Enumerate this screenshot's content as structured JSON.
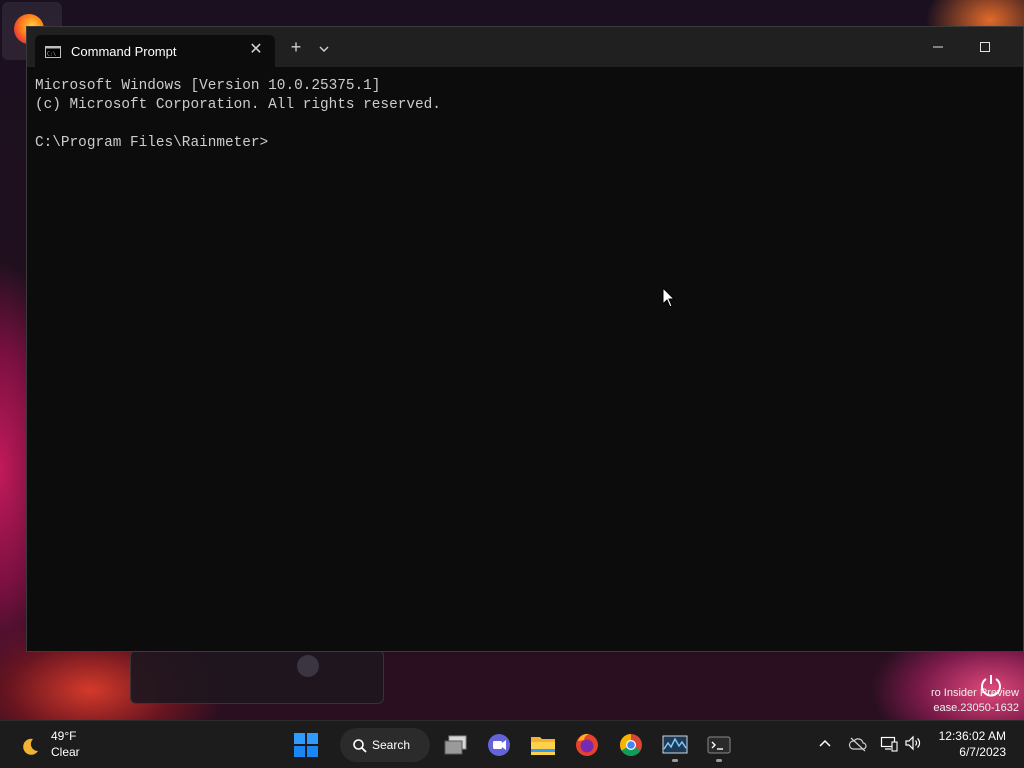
{
  "desktop": {
    "insider_line1": "ro Insider Preview",
    "insider_line2": "ease.23050-1632"
  },
  "window": {
    "tab_title": "Command Prompt",
    "console_lines": [
      "Microsoft Windows [Version 10.0.25375.1]",
      "(c) Microsoft Corporation. All rights reserved.",
      "",
      "C:\\Program Files\\Rainmeter>"
    ]
  },
  "taskbar": {
    "weather_temp": "49°F",
    "weather_condition": "Clear",
    "search_label": "Search",
    "time": "12:36:02 AM",
    "date": "6/7/2023",
    "icons": [
      "start-icon",
      "search-icon",
      "task-view-icon",
      "chat-icon",
      "file-explorer-icon",
      "firefox-icon",
      "chrome-icon",
      "resource-monitor-icon",
      "terminal-icon"
    ]
  },
  "colors": {
    "console_bg": "#0c0c0c",
    "console_text": "#cccccc",
    "titlebar": "#202020",
    "taskbar": "#1c1c1c",
    "start_blue": "#0a84ff"
  }
}
